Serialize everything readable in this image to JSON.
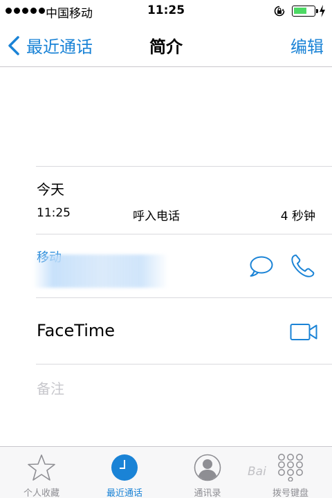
{
  "status_bar": {
    "carrier": "中国移动",
    "time": "11:25"
  },
  "nav": {
    "back_label": "最近通话",
    "title": "简介",
    "edit_label": "编辑"
  },
  "call_log": {
    "day": "今天",
    "time": "11:25",
    "type": "呼入电话",
    "duration": "4 秒钟"
  },
  "phone": {
    "label": "移动"
  },
  "facetime": {
    "label": "FaceTime"
  },
  "notes": {
    "label": "备注"
  },
  "tabs": [
    {
      "label": "个人收藏",
      "icon": "star-icon",
      "active": false
    },
    {
      "label": "最近通话",
      "icon": "clock-icon",
      "active": true
    },
    {
      "label": "通讯录",
      "icon": "contacts-icon",
      "active": false
    },
    {
      "label": "拨号键盘",
      "icon": "keypad-icon",
      "active": false
    }
  ],
  "watermark": "Bai",
  "colors": {
    "accent": "#1a83d6",
    "battery": "#4cd964",
    "placeholder": "#c7c7cc"
  }
}
